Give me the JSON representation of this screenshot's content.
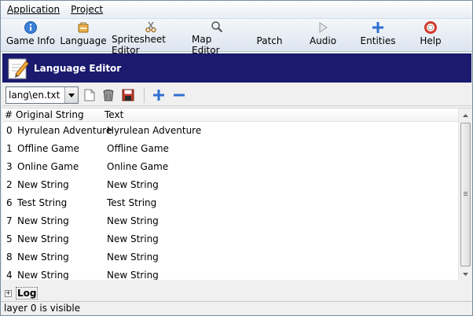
{
  "menu": {
    "items": [
      {
        "label": "Application"
      },
      {
        "label": "Project"
      }
    ]
  },
  "toolbar": {
    "tools": [
      {
        "label": "Game Info",
        "icon": "info-icon"
      },
      {
        "label": "Language",
        "icon": "language-icon"
      },
      {
        "label": "Spritesheet Editor",
        "icon": "scissors-icon"
      },
      {
        "label": "Map Editor",
        "icon": "magnifier-icon"
      },
      {
        "label": "Patch",
        "icon": ""
      },
      {
        "label": "Audio",
        "icon": "play-icon"
      },
      {
        "label": "Entities",
        "icon": "plus-icon"
      },
      {
        "label": "Help",
        "icon": "lifebuoy-icon"
      }
    ]
  },
  "banner": {
    "title": "Language Editor"
  },
  "editor": {
    "file_select": "lang\\en.txt"
  },
  "table": {
    "headers": [
      "#",
      "Original String",
      "Text"
    ],
    "rows": [
      {
        "idx": "0",
        "orig": "Hyrulean Adventure",
        "text": "Hyrulean Adventure"
      },
      {
        "idx": "1",
        "orig": "Offline Game",
        "text": "Offline Game"
      },
      {
        "idx": "3",
        "orig": "Online Game",
        "text": "Online Game"
      },
      {
        "idx": "2",
        "orig": "New String",
        "text": "New String"
      },
      {
        "idx": "6",
        "orig": "Test String",
        "text": "Test String"
      },
      {
        "idx": "7",
        "orig": "New String",
        "text": "New String"
      },
      {
        "idx": "5",
        "orig": "New String",
        "text": "New String"
      },
      {
        "idx": "8",
        "orig": "New String",
        "text": "New String"
      },
      {
        "idx": "4",
        "orig": "New String",
        "text": "New String"
      }
    ]
  },
  "log": {
    "label": "Log",
    "expander": "+"
  },
  "status": {
    "text": "layer 0 is visible"
  },
  "colors": {
    "banner_bg": "#1a1a6e",
    "accent_blue": "#2f6fd0"
  }
}
